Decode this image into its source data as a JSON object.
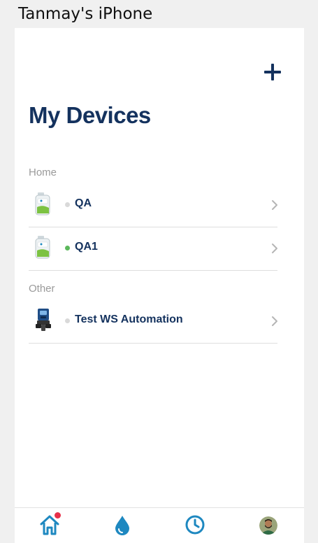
{
  "window_title": "Tanmay's iPhone",
  "page_title": "My Devices",
  "sections": [
    {
      "header": "Home",
      "devices": [
        {
          "name": "QA",
          "status_color": "#d9d9d9",
          "image": "water-softener-icon"
        },
        {
          "name": "QA1",
          "status_color": "#5cb85c",
          "image": "water-softener-icon"
        }
      ]
    },
    {
      "header": "Other",
      "devices": [
        {
          "name": "Test WS Automation",
          "status_color": "#d9d9d9",
          "image": "valve-controller-icon"
        }
      ]
    }
  ],
  "tabs": [
    {
      "name": "home",
      "icon": "home-icon",
      "active": true,
      "has_notification": true
    },
    {
      "name": "water",
      "icon": "water-drop-icon",
      "active": false
    },
    {
      "name": "history",
      "icon": "clock-icon",
      "active": false
    },
    {
      "name": "profile",
      "icon": "avatar",
      "active": false
    }
  ],
  "colors": {
    "primary": "#14325e",
    "accent": "#1e88c0",
    "notification": "#e8304a",
    "online": "#5cb85c",
    "offline": "#d9d9d9"
  }
}
